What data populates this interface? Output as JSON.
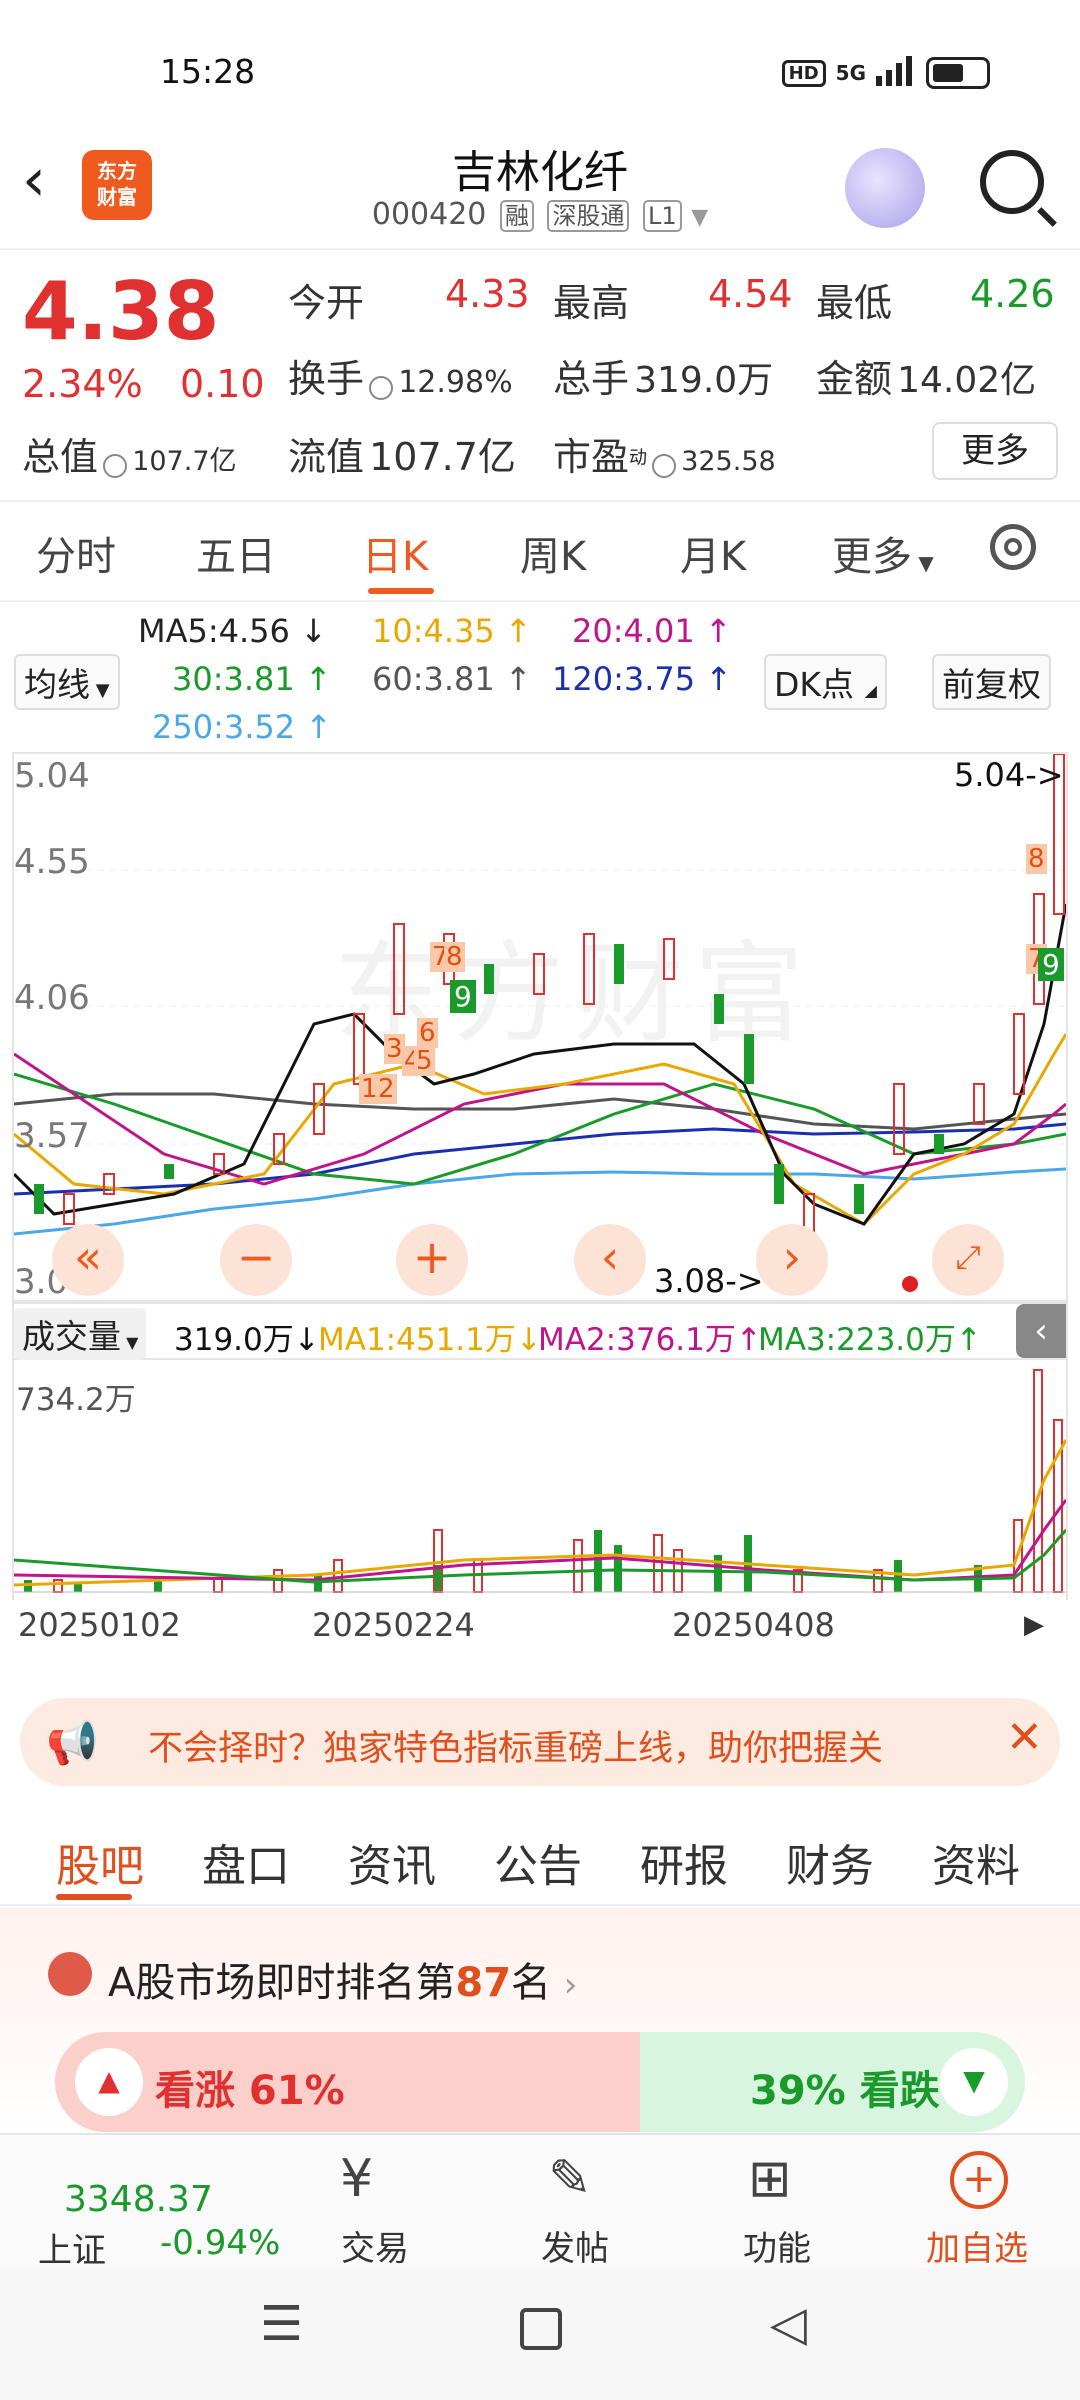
{
  "status_bar": {
    "time": "15:28",
    "hd": "HD",
    "network": "5G"
  },
  "header": {
    "logo_text": "东方财富",
    "title": "吉林化纤",
    "code": "000420",
    "tags": [
      "融",
      "深股通",
      "L1"
    ]
  },
  "quote": {
    "price": "4.38",
    "change_pct": "2.34%",
    "change": "0.10",
    "open_label": "今开",
    "open": "4.33",
    "high_label": "最高",
    "high": "4.54",
    "low_label": "最低",
    "low": "4.26",
    "turnover_label": "换手",
    "turnover": "12.98%",
    "volume_label": "总手",
    "volume": "319.0万",
    "amount_label": "金额",
    "amount": "14.02亿",
    "mktcap_label": "总值",
    "mktcap": "107.7亿",
    "float_label": "流值",
    "float_cap": "107.7亿",
    "pe_label": "市盈",
    "pe_sup": "动",
    "pe": "325.58",
    "more": "更多"
  },
  "period_tabs": [
    "分时",
    "五日",
    "日K",
    "周K",
    "月K",
    "更多"
  ],
  "active_period": "日K",
  "ma_legend": {
    "ma5": "MA5:4.56",
    "ma10": "10:4.35",
    "ma20": "20:4.01",
    "ma30": "30:3.81",
    "ma60": "60:3.81",
    "ma120": "120:3.75",
    "ma250": "250:3.52",
    "ma_select": "均线",
    "dk_point": "DK点",
    "fq": "前复权"
  },
  "kchart": {
    "y_labels": [
      "5.04",
      "4.55",
      "4.06",
      "3.57",
      "3.08"
    ],
    "max_marker": "5.04->",
    "min_marker": "3.08->",
    "watermark": "东方财富",
    "signal_labels": [
      "1",
      "2",
      "3",
      "4",
      "5",
      "6",
      "7",
      "8",
      "9"
    ]
  },
  "volume": {
    "indicator": "成交量",
    "value": "319.0万",
    "ma1": "MA1:451.1万",
    "ma2": "MA2:376.1万",
    "ma3": "MA3:223.0万",
    "max_label": "734.2万",
    "dates": [
      "20250102",
      "20250224",
      "20250408"
    ]
  },
  "promo": {
    "text": "不会择时？独家特色指标重磅上线，助你把握关"
  },
  "community_tabs": [
    "股吧",
    "盘口",
    "资讯",
    "公告",
    "研报",
    "财务",
    "资料"
  ],
  "active_community_tab": "股吧",
  "ranking": {
    "prefix": "A股市场即时排名第",
    "rank": "87",
    "suffix": "名"
  },
  "sentiment": {
    "bull": "看涨 61%",
    "bear": "39% 看跌"
  },
  "bottom_nav": {
    "index_value": "3348.37",
    "index_name": "上证",
    "index_change": "-0.94%",
    "items": [
      "交易",
      "发帖",
      "功能",
      "加自选"
    ]
  },
  "colors": {
    "up": "#e03030",
    "down": "#1a9a2a",
    "accent": "#f05a1e"
  }
}
